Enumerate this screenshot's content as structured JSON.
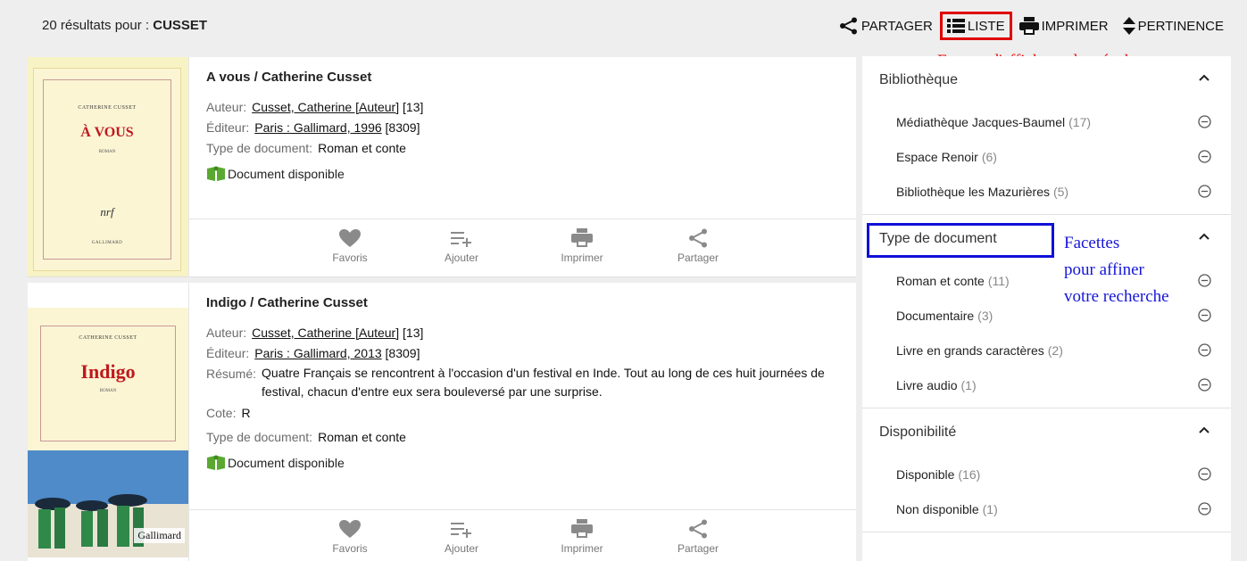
{
  "header": {
    "count_prefix": "20 résultats pour : ",
    "query": "CUSSET",
    "actions": [
      {
        "label": "PARTAGER",
        "icon": "share-icon"
      },
      {
        "label": "LISTE",
        "icon": "list-icon"
      },
      {
        "label": "IMPRIMER",
        "icon": "print-icon"
      },
      {
        "label": "PERTINENCE",
        "icon": "sort-icon"
      }
    ]
  },
  "annotations": {
    "format": "Format d'affichage des résultats",
    "facets_line1": "Facettes",
    "facets_line2": "pour affiner",
    "facets_line3": "votre recherche"
  },
  "results": [
    {
      "title": "A vous / Catherine Cusset",
      "cover": {
        "author": "CATHERINE CUSSET",
        "title": "À VOUS",
        "sub": "ROMAN",
        "logo": "nrf",
        "publisher": "GALLIMARD"
      },
      "author_label": "Auteur:",
      "author_link": "Cusset, Catherine [Auteur]",
      "author_extra": " [13]",
      "publisher_label": "Éditeur:",
      "publisher_link": "Paris : Gallimard, 1996",
      "publisher_extra": " [8309]",
      "doctype_label": "Type de document:",
      "doctype": "Roman et conte",
      "availability": "Document disponible"
    },
    {
      "title": "Indigo / Catherine Cusset",
      "cover": {
        "author": "CATHERINE CUSSET",
        "title": "Indigo",
        "sub": "ROMAN",
        "publisher": "Gallimard"
      },
      "author_label": "Auteur:",
      "author_link": "Cusset, Catherine [Auteur]",
      "author_extra": " [13]",
      "publisher_label": "Éditeur:",
      "publisher_link": "Paris : Gallimard, 2013",
      "publisher_extra": " [8309]",
      "summary_label": "Résumé:",
      "summary": "Quatre Français se rencontrent à l'occasion d'un festival en Inde. Tout au long de ces huit journées de festival, chacun d'entre eux sera bouleversé par une surprise.",
      "cote_label": "Cote:",
      "cote": "R",
      "doctype_label": "Type de document:",
      "doctype": "Roman et conte",
      "availability": "Document disponible"
    }
  ],
  "card_tools": [
    "Favoris",
    "Ajouter",
    "Imprimer",
    "Partager"
  ],
  "facets": [
    {
      "title": "Bibliothèque",
      "items": [
        {
          "label": "Médiathèque Jacques-Baumel",
          "count": "(17)"
        },
        {
          "label": "Espace Renoir",
          "count": "(6)"
        },
        {
          "label": "Bibliothèque les Mazurières",
          "count": "(5)"
        }
      ]
    },
    {
      "title": "Type de document",
      "items": [
        {
          "label": "Roman et conte",
          "count": "(11)"
        },
        {
          "label": "Documentaire",
          "count": "(3)"
        },
        {
          "label": "Livre en grands caractères",
          "count": "(2)"
        },
        {
          "label": "Livre audio",
          "count": "(1)"
        }
      ]
    },
    {
      "title": "Disponibilité",
      "items": [
        {
          "label": "Disponible",
          "count": "(16)"
        },
        {
          "label": "Non disponible",
          "count": "(1)"
        }
      ]
    }
  ],
  "colors": {
    "highlight_red": "#e00000",
    "highlight_blue": "#1010d8",
    "available_green": "#5aa832"
  }
}
